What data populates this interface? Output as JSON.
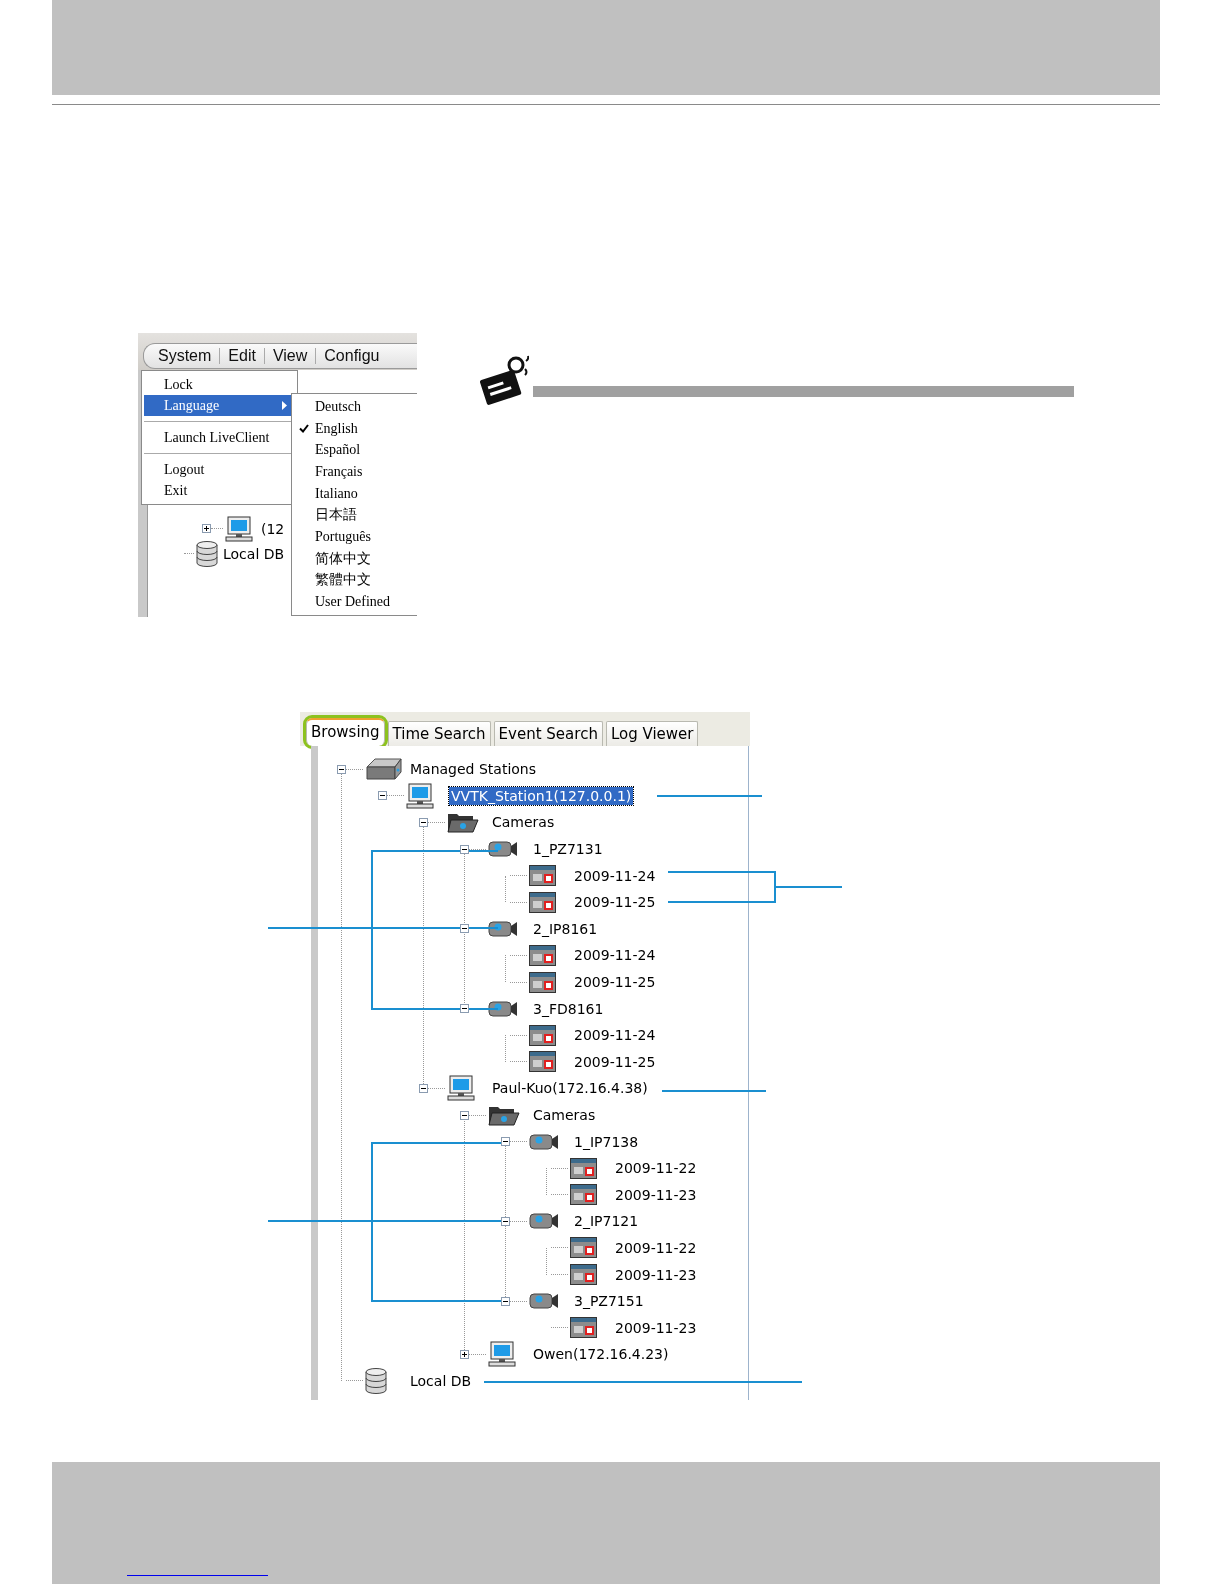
{
  "menu_screenshot": {
    "menubar": [
      "System",
      "Edit",
      "View",
      "Configu"
    ],
    "background_tree": [
      {
        "label": "(12",
        "kind": "computer",
        "expanded": false
      },
      {
        "label": "Local DB",
        "kind": "database"
      }
    ],
    "menu": [
      {
        "kind": "item",
        "label": "Lock",
        "selected": false,
        "has_submenu": false
      },
      {
        "kind": "item",
        "label": "Language",
        "selected": true,
        "has_submenu": true
      },
      {
        "kind": "separator"
      },
      {
        "kind": "item",
        "label": "Launch LiveClient",
        "selected": false,
        "has_submenu": false
      },
      {
        "kind": "separator"
      },
      {
        "kind": "item",
        "label": "Logout",
        "selected": false,
        "has_submenu": false
      },
      {
        "kind": "item",
        "label": "Exit",
        "selected": false,
        "has_submenu": false
      }
    ],
    "submenu": [
      {
        "label": "Deutsch",
        "checked": false
      },
      {
        "label": "English",
        "checked": true
      },
      {
        "label": "Español",
        "checked": false
      },
      {
        "label": "Français",
        "checked": false
      },
      {
        "label": "Italiano",
        "checked": false
      },
      {
        "label": "日本語",
        "checked": false
      },
      {
        "label": "Português",
        "checked": false
      },
      {
        "label": "简体中文",
        "checked": false
      },
      {
        "label": "繁體中文",
        "checked": false
      },
      {
        "label": "User Defined",
        "checked": false
      }
    ]
  },
  "browser_screenshot": {
    "tabs": [
      {
        "label": "Browsing",
        "selected": true,
        "highlighted": true
      },
      {
        "label": "Time Search",
        "selected": false,
        "highlighted": false
      },
      {
        "label": "Event Search",
        "selected": false,
        "highlighted": false
      },
      {
        "label": "Log Viewer",
        "selected": false,
        "highlighted": false
      }
    ],
    "tree": [
      {
        "label": "Managed Stations",
        "kind": "station",
        "expanded": true,
        "selected": false,
        "children": [
          {
            "label": "VVTK_Station1(127.0.0.1)",
            "kind": "computer",
            "expanded": true,
            "selected": true,
            "children": [
              {
                "label": "Cameras",
                "kind": "folder",
                "expanded": true,
                "selected": false,
                "children": [
                  {
                    "label": "1_PZ7131",
                    "kind": "camera",
                    "expanded": true,
                    "selected": false,
                    "children": [
                      {
                        "label": "2009-11-24",
                        "kind": "recording",
                        "selected": false
                      },
                      {
                        "label": "2009-11-25",
                        "kind": "recording",
                        "selected": false
                      }
                    ]
                  },
                  {
                    "label": "2_IP8161",
                    "kind": "camera",
                    "expanded": true,
                    "selected": false,
                    "children": [
                      {
                        "label": "2009-11-24",
                        "kind": "recording",
                        "selected": false
                      },
                      {
                        "label": "2009-11-25",
                        "kind": "recording",
                        "selected": false
                      }
                    ]
                  },
                  {
                    "label": "3_FD8161",
                    "kind": "camera",
                    "expanded": true,
                    "selected": false,
                    "children": [
                      {
                        "label": "2009-11-24",
                        "kind": "recording",
                        "selected": false
                      },
                      {
                        "label": "2009-11-25",
                        "kind": "recording",
                        "selected": false
                      }
                    ]
                  }
                ]
              },
              {
                "label": "Paul-Kuo(172.16.4.38)",
                "kind": "computer",
                "expanded": true,
                "selected": false,
                "children": [
                  {
                    "label": "Cameras",
                    "kind": "folder",
                    "expanded": true,
                    "selected": false,
                    "children": [
                      {
                        "label": "1_IP7138",
                        "kind": "camera",
                        "expanded": true,
                        "selected": false,
                        "children": [
                          {
                            "label": "2009-11-22",
                            "kind": "recording",
                            "selected": false
                          },
                          {
                            "label": "2009-11-23",
                            "kind": "recording",
                            "selected": false
                          }
                        ]
                      },
                      {
                        "label": "2_IP7121",
                        "kind": "camera",
                        "expanded": true,
                        "selected": false,
                        "children": [
                          {
                            "label": "2009-11-22",
                            "kind": "recording",
                            "selected": false
                          },
                          {
                            "label": "2009-11-23",
                            "kind": "recording",
                            "selected": false
                          }
                        ]
                      },
                      {
                        "label": "3_PZ7151",
                        "kind": "camera",
                        "expanded": true,
                        "selected": false,
                        "children": [
                          {
                            "label": "2009-11-23",
                            "kind": "recording",
                            "selected": false
                          }
                        ]
                      }
                    ]
                  },
                  {
                    "label": "Owen(172.16.4.23)",
                    "kind": "computer",
                    "expanded": false,
                    "selected": false
                  }
                ]
              }
            ]
          }
        ]
      },
      {
        "label": "Local DB",
        "kind": "database",
        "selected": false
      }
    ]
  }
}
